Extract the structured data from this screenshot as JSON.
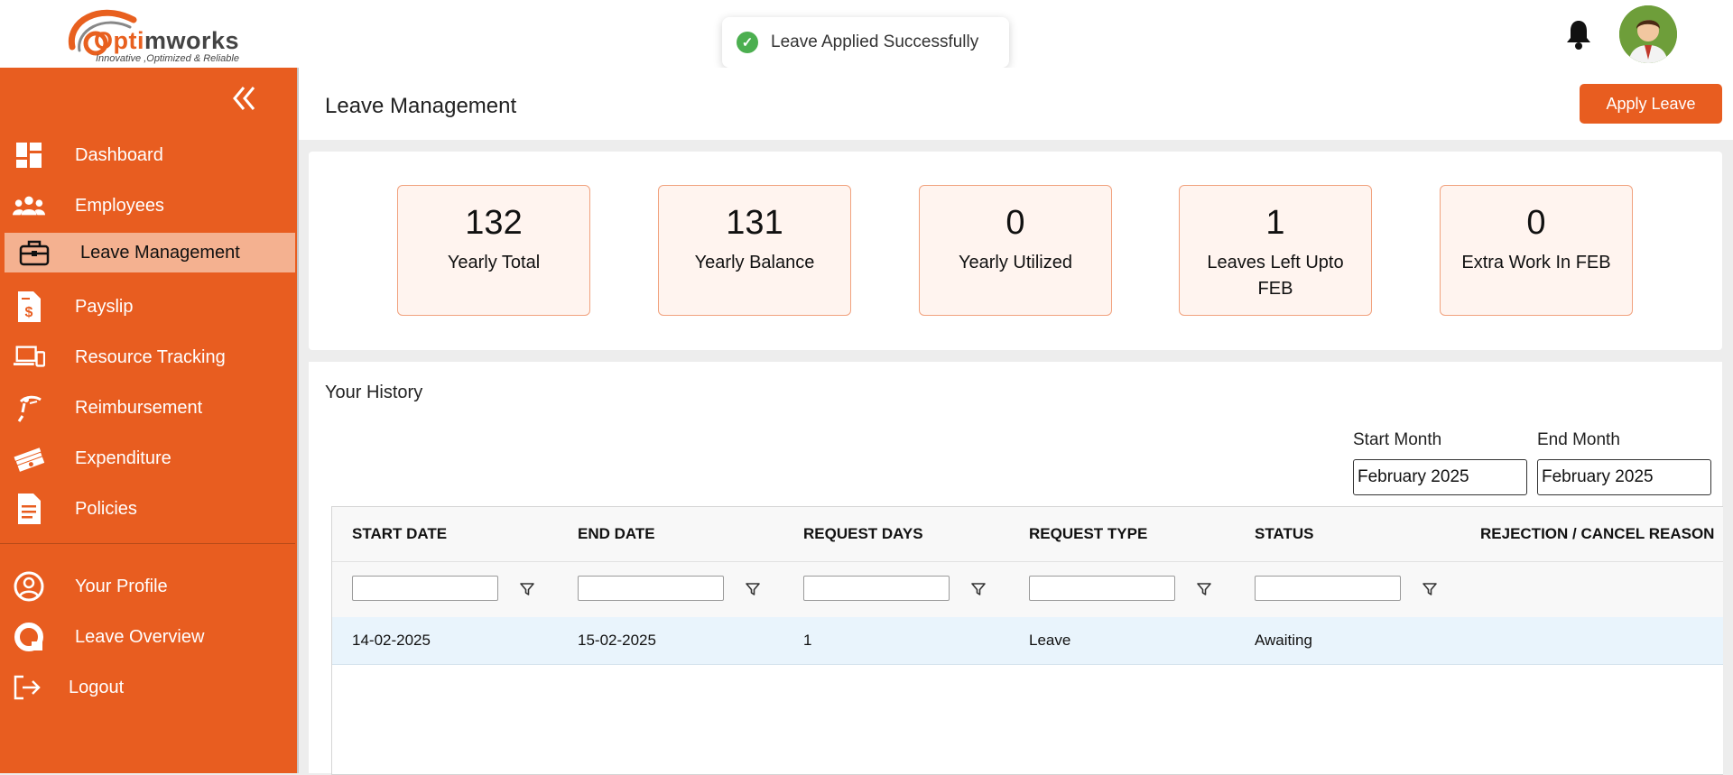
{
  "header": {
    "logo_brand_accent": "Opti",
    "logo_brand_rest": "mworks",
    "logo_tagline": "Innovative ,Optimized & Reliable",
    "toast_message": "Leave Applied Successfully"
  },
  "sidebar": {
    "items": [
      {
        "label": "Dashboard",
        "icon": "dashboard-icon"
      },
      {
        "label": "Employees",
        "icon": "employees-icon"
      },
      {
        "label": "Leave Management",
        "icon": "briefcase-icon",
        "active": true
      },
      {
        "label": "Payslip",
        "icon": "payslip-icon"
      },
      {
        "label": "Resource Tracking",
        "icon": "devices-icon"
      },
      {
        "label": "Reimbursement",
        "icon": "reimbursement-icon"
      },
      {
        "label": "Expenditure",
        "icon": "money-icon"
      },
      {
        "label": "Policies",
        "icon": "document-icon"
      },
      {
        "label": "Your Profile",
        "icon": "user-circle-icon"
      },
      {
        "label": "Leave Overview",
        "icon": "overview-icon"
      },
      {
        "label": "Logout",
        "icon": "logout-icon"
      }
    ]
  },
  "main": {
    "title": "Leave Management",
    "apply_button": "Apply Leave"
  },
  "stats": [
    {
      "value": "132",
      "label": "Yearly Total"
    },
    {
      "value": "131",
      "label": "Yearly Balance"
    },
    {
      "value": "0",
      "label": "Yearly Utilized"
    },
    {
      "value": "1",
      "label": "Leaves Left Upto FEB"
    },
    {
      "value": "0",
      "label": "Extra Work In FEB"
    }
  ],
  "history": {
    "title": "Your History",
    "start_month_label": "Start Month",
    "start_month_value": "February 2025",
    "end_month_label": "End Month",
    "end_month_value": "February 2025",
    "columns": [
      "START DATE",
      "END DATE",
      "REQUEST DAYS",
      "REQUEST TYPE",
      "STATUS",
      "REJECTION / CANCEL REASON"
    ],
    "rows": [
      [
        "14-02-2025",
        "15-02-2025",
        "1",
        "Leave",
        "Awaiting",
        ""
      ]
    ]
  },
  "colors": {
    "accent": "#e85d20",
    "active_nav": "#f4b190",
    "stat_bg": "#fff4ef",
    "row_highlight": "#e9f4fc",
    "toast_success": "#4caf50"
  }
}
